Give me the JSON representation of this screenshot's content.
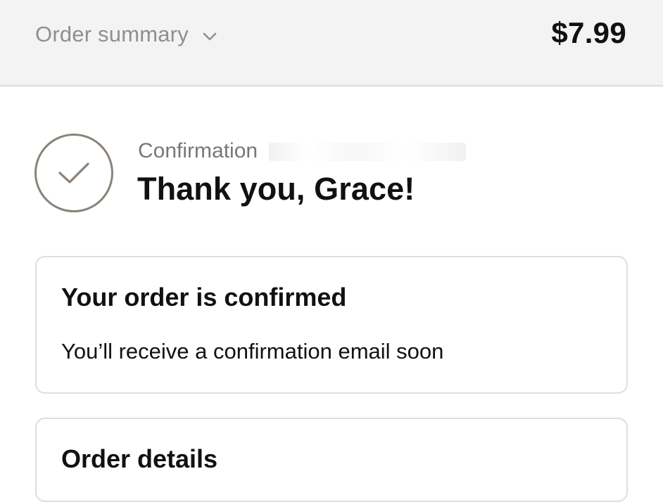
{
  "header": {
    "summary_label": "Order summary",
    "summary_icon": "chevron-down-icon",
    "total": "$7.99"
  },
  "status": {
    "icon": "checkmark-circle-icon",
    "confirmation_label": "Confirmation",
    "thank_you": "Thank you, Grace!"
  },
  "cards": {
    "confirmed": {
      "title": "Your order is confirmed",
      "text": "You’ll receive a confirmation email soon"
    },
    "details": {
      "title": "Order details"
    }
  },
  "colors": {
    "header_background": "#f3f3f3",
    "muted_text": "#8f8f8f",
    "check_color": "#8b8279",
    "card_border": "#dedede",
    "text": "#111111"
  }
}
